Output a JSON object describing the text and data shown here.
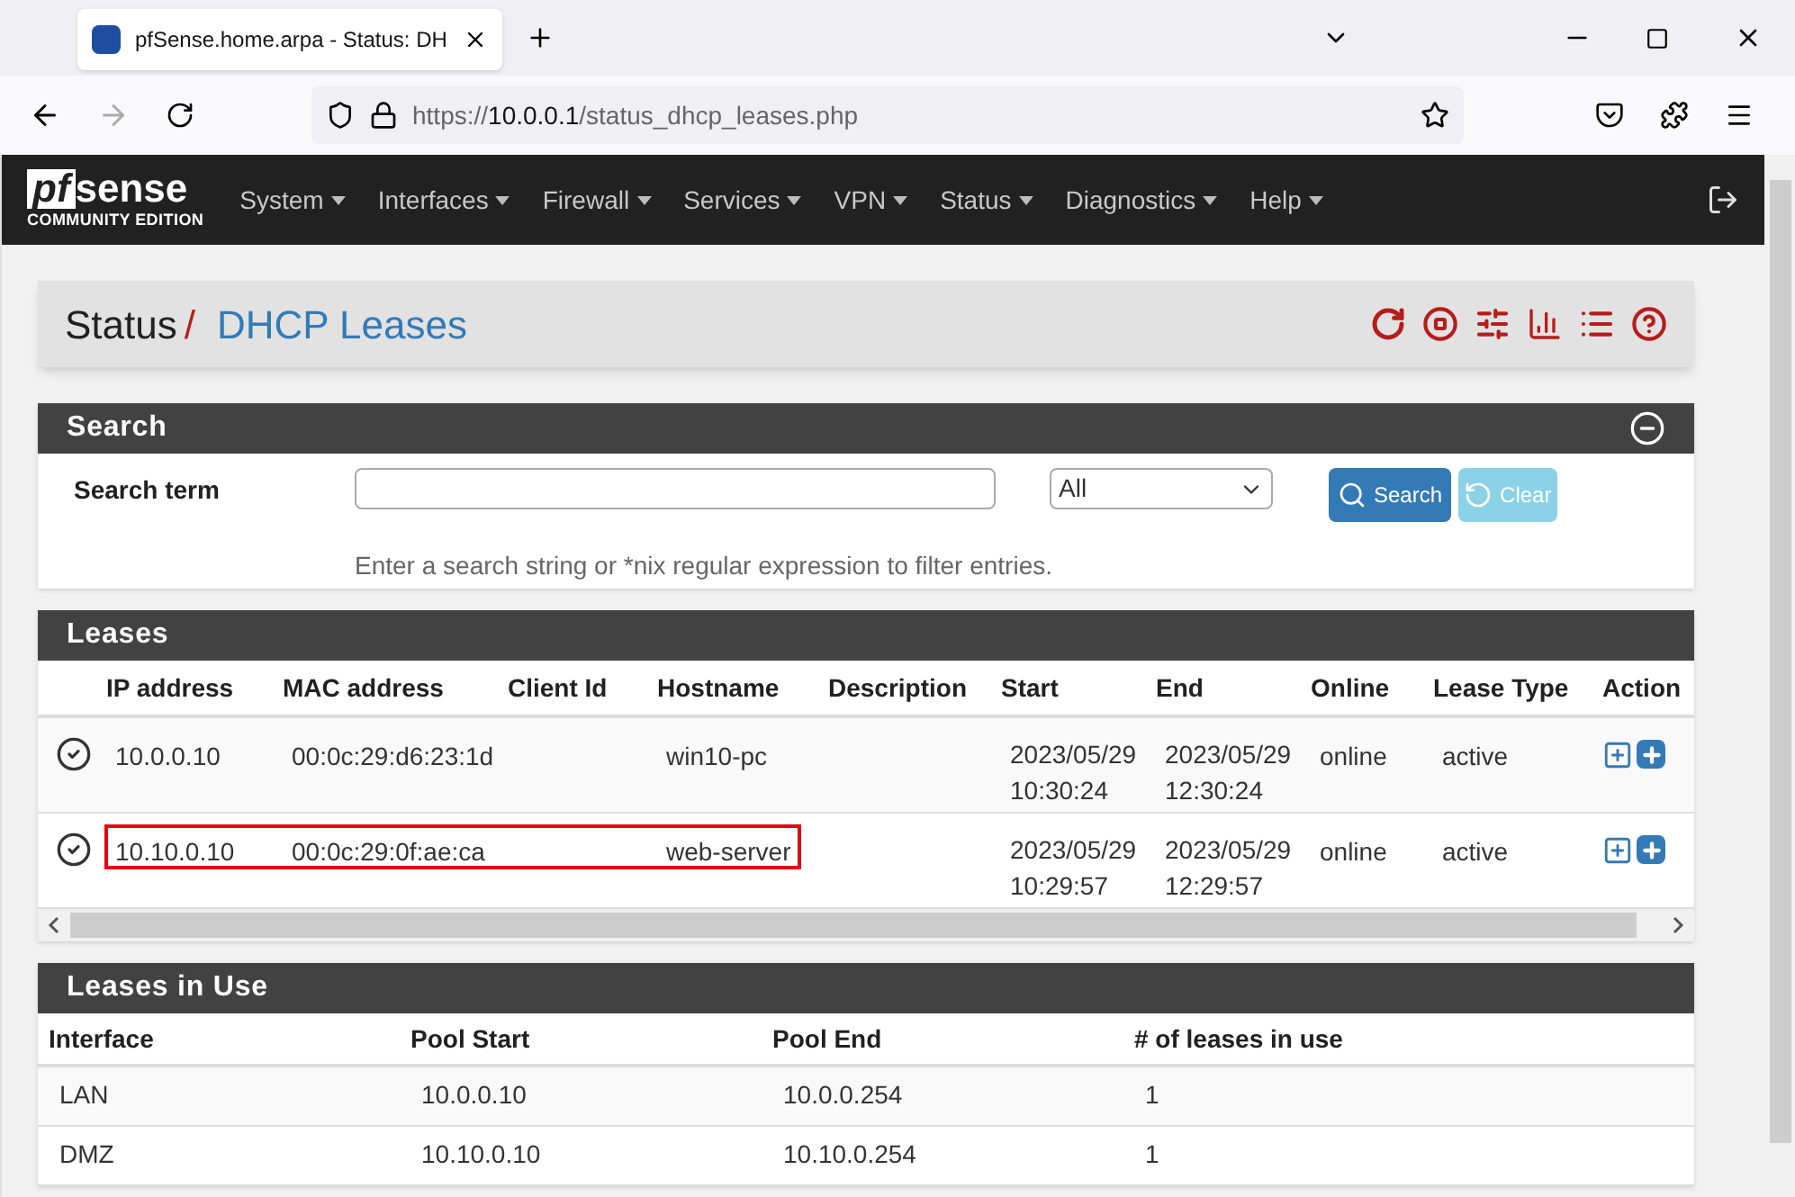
{
  "browser": {
    "tab": {
      "title": "pfSense.home.arpa - Status: DH",
      "selected": true
    },
    "url": {
      "scheme": "https://",
      "host": "10.0.0.1",
      "path": "/status_dhcp_leases.php"
    }
  },
  "navbar": {
    "logo": {
      "mark": "pf",
      "word": "sense",
      "edition": "COMMUNITY EDITION"
    },
    "menu": [
      {
        "label": "System"
      },
      {
        "label": "Interfaces"
      },
      {
        "label": "Firewall"
      },
      {
        "label": "Services"
      },
      {
        "label": "VPN"
      },
      {
        "label": "Status"
      },
      {
        "label": "Diagnostics"
      },
      {
        "label": "Help"
      }
    ]
  },
  "breadcrumb": {
    "parent": "Status",
    "separator": "/",
    "current": "DHCP Leases"
  },
  "search": {
    "title": "Search",
    "label": "Search term",
    "select_value": "All",
    "search_button": "Search",
    "clear_button": "Clear",
    "clear_disabled": true,
    "help": "Enter a search string or *nix regular expression to filter entries."
  },
  "leases": {
    "title": "Leases",
    "columns": [
      "IP address",
      "MAC address",
      "Client Id",
      "Hostname",
      "Description",
      "Start",
      "End",
      "Online",
      "Lease Type",
      "Action"
    ],
    "rows": [
      {
        "ip": "10.0.0.10",
        "mac": "00:0c:29:d6:23:1d",
        "hostname": "win10-pc",
        "start": [
          "2023/05/29",
          "10:30:24"
        ],
        "end": [
          "2023/05/29",
          "12:30:24"
        ],
        "online": "online",
        "type": "active",
        "highlighted": false
      },
      {
        "ip": "10.10.0.10",
        "mac": "00:0c:29:0f:ae:ca",
        "hostname": "web-server",
        "start": [
          "2023/05/29",
          "10:29:57"
        ],
        "end": [
          "2023/05/29",
          "12:29:57"
        ],
        "online": "online",
        "type": "active",
        "highlighted": true
      }
    ]
  },
  "leases_in_use": {
    "title": "Leases in Use",
    "columns": [
      "Interface",
      "Pool Start",
      "Pool End",
      "# of leases in use"
    ],
    "rows": [
      [
        "LAN",
        "10.0.0.10",
        "10.0.0.254",
        "1"
      ],
      [
        "DMZ",
        "10.10.0.10",
        "10.10.0.254",
        "1"
      ]
    ]
  }
}
